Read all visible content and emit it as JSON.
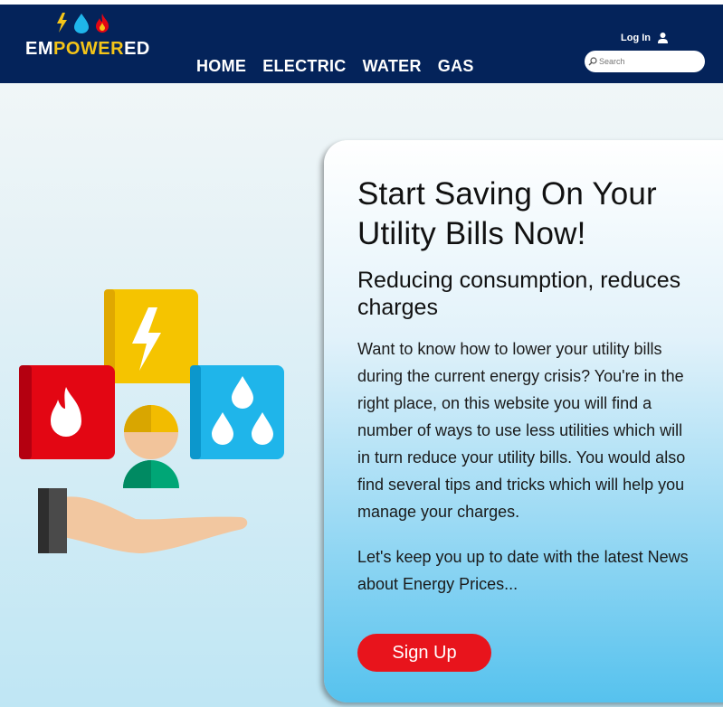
{
  "brand": {
    "name_part1": "EM",
    "name_part2": "POWER",
    "name_part3": "ED",
    "icons": [
      "lightning-icon",
      "water-drop-icon",
      "flame-icon"
    ]
  },
  "nav": {
    "items": [
      {
        "label": "HOME"
      },
      {
        "label": "ELECTRIC"
      },
      {
        "label": "WATER"
      },
      {
        "label": "GAS"
      }
    ]
  },
  "header": {
    "login_label": "Log In",
    "search_placeholder": "Search"
  },
  "hero": {
    "title": "Start Saving On Your Utility Bills Now!",
    "subtitle": "Reducing consumption, reduces charges",
    "body": "Want to know how to lower your utility bills during the current energy crisis? You're in the right place, on this website you will find a number of ways to use less utilities which will in turn reduce your utility bills. You would also find several tips and tricks which will help you manage your charges.",
    "news": "Let's keep you up to date with the latest News about Energy Prices...",
    "cta_label": "Sign Up"
  },
  "colors": {
    "header_bg": "#04235a",
    "accent_yellow": "#f5c518",
    "cta_red": "#e8141c",
    "gas_red": "#e30613",
    "electric_yellow": "#f5c400",
    "water_blue": "#1fb5ea"
  }
}
